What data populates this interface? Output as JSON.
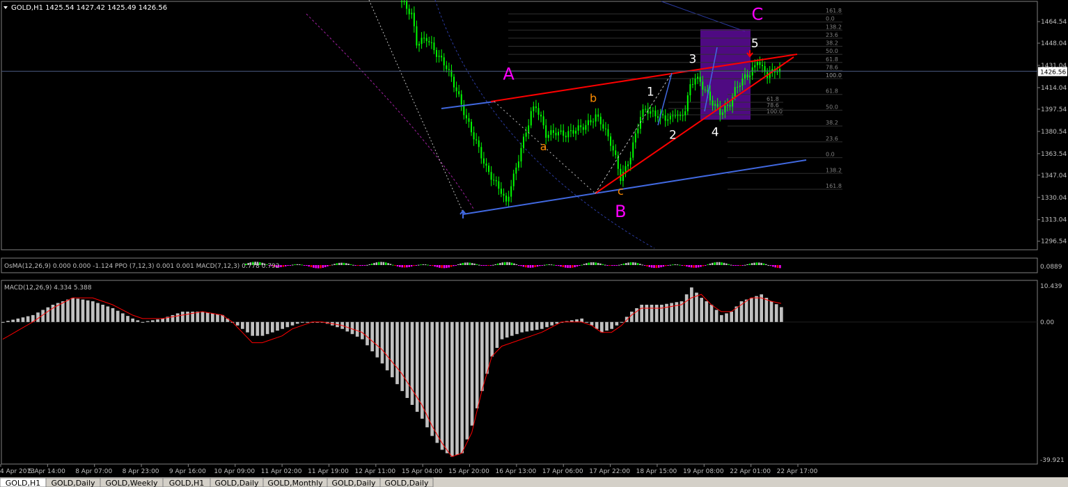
{
  "window": {
    "symbol_info": "GOLD,H1 1425.54 1427.42 1425.49 1426.56",
    "current_price": "1426.56"
  },
  "tabs": [
    "GOLD,H1",
    "GOLD,Daily",
    "GOLD,Weekly",
    "GOLD,H1",
    "GOLD,Daily",
    "GOLD,Monthly",
    "GOLD,Daily",
    "GOLD,Daily"
  ],
  "active_tab": 0,
  "colors": {
    "background": "#000000",
    "grid": "#808080",
    "candle": "#00ff00",
    "red_line": "#ff0000",
    "blue_line": "#4169e1",
    "wave_magenta": "#ff00ff",
    "wave_orange": "#ff8c00",
    "wave_white": "#ffffff",
    "fib_text": "#808080",
    "box": "#6a0dad",
    "macd_hist": "#c0c0c0",
    "macd_signal": "#ff0000"
  },
  "chart_data": [
    {
      "type": "candlestick",
      "title": "GOLD,H1",
      "ylim": [
        1290,
        1480
      ],
      "y_ticks": [
        "1464.54",
        "1448.04",
        "1431.04",
        "1414.04",
        "1397.54",
        "1380.54",
        "1363.54",
        "1347.04",
        "1330.04",
        "1313.04",
        "1296.54"
      ],
      "x_tick_labels": [
        "4 Apr 2013",
        "5 Apr 14:00",
        "8 Apr 07:00",
        "8 Apr 23:00",
        "9 Apr 16:00",
        "10 Apr 09:00",
        "11 Apr 02:00",
        "11 Apr 19:00",
        "12 Apr 11:00",
        "15 Apr 04:00",
        "15 Apr 20:00",
        "16 Apr 13:00",
        "17 Apr 06:00",
        "17 Apr 22:00",
        "18 Apr 15:00",
        "19 Apr 08:00",
        "22 Apr 01:00",
        "22 Apr 17:00"
      ],
      "close_path": [
        [
          0,
          1480
        ],
        [
          4,
          1470
        ],
        [
          6,
          1448
        ],
        [
          10,
          1452
        ],
        [
          14,
          1440
        ],
        [
          18,
          1430
        ],
        [
          22,
          1412
        ],
        [
          26,
          1390
        ],
        [
          30,
          1372
        ],
        [
          34,
          1352
        ],
        [
          38,
          1340
        ],
        [
          40,
          1335
        ],
        [
          42,
          1325
        ],
        [
          44,
          1340
        ],
        [
          46,
          1352
        ],
        [
          48,
          1368
        ],
        [
          50,
          1380
        ],
        [
          52,
          1395
        ],
        [
          54,
          1400
        ],
        [
          56,
          1390
        ],
        [
          58,
          1378
        ],
        [
          62,
          1380
        ],
        [
          66,
          1378
        ],
        [
          70,
          1382
        ],
        [
          74,
          1385
        ],
        [
          78,
          1392
        ],
        [
          80,
          1388
        ],
        [
          82,
          1380
        ],
        [
          84,
          1372
        ],
        [
          86,
          1360
        ],
        [
          88,
          1345
        ],
        [
          90,
          1352
        ],
        [
          92,
          1362
        ],
        [
          94,
          1378
        ],
        [
          96,
          1392
        ],
        [
          98,
          1398
        ],
        [
          100,
          1395
        ],
        [
          104,
          1392
        ],
        [
          108,
          1390
        ],
        [
          110,
          1395
        ],
        [
          112,
          1390
        ],
        [
          114,
          1398
        ],
        [
          116,
          1415
        ],
        [
          118,
          1422
        ],
        [
          120,
          1418
        ],
        [
          122,
          1412
        ],
        [
          124,
          1405
        ],
        [
          126,
          1400
        ],
        [
          128,
          1395
        ],
        [
          130,
          1398
        ],
        [
          132,
          1402
        ],
        [
          134,
          1412
        ],
        [
          136,
          1418
        ],
        [
          138,
          1422
        ],
        [
          140,
          1425
        ],
        [
          142,
          1430
        ],
        [
          143,
          1436
        ],
        [
          145,
          1428
        ],
        [
          147,
          1424
        ],
        [
          149,
          1426
        ],
        [
          151,
          1428
        ],
        [
          152,
          1426.56
        ]
      ],
      "current_price": 1426.56,
      "wave_labels": [
        {
          "text": "A",
          "x": 43,
          "y": 1420,
          "color": "magenta"
        },
        {
          "text": "B",
          "x": 88,
          "y": 1315,
          "color": "magenta"
        },
        {
          "text": "C",
          "x": 143,
          "y": 1466,
          "color": "magenta"
        },
        {
          "text": "a",
          "x": 57,
          "y": 1366,
          "color": "orange"
        },
        {
          "text": "b",
          "x": 77,
          "y": 1403,
          "color": "orange"
        },
        {
          "text": "c",
          "x": 88,
          "y": 1332,
          "color": "orange"
        },
        {
          "text": "1",
          "x": 100,
          "y": 1408,
          "color": "white"
        },
        {
          "text": "2",
          "x": 109,
          "y": 1375,
          "color": "white"
        },
        {
          "text": "3",
          "x": 117,
          "y": 1433,
          "color": "white"
        },
        {
          "text": "4",
          "x": 126,
          "y": 1377,
          "color": "white"
        },
        {
          "text": "5",
          "x": 142,
          "y": 1445,
          "color": "white"
        }
      ],
      "fib_levels_upper": [
        "161.8",
        "0.0",
        "138.2",
        "23.6",
        "38.2",
        "50.0",
        "61.8",
        "78.6",
        "100.0"
      ],
      "fib_levels_mid": [
        "100.0",
        "78.6",
        "61.8"
      ],
      "fib_levels_lower": [
        "100.0",
        "61.8",
        "50.0",
        "38.2",
        "23.6",
        "0.0",
        "138.2",
        "161.8"
      ]
    },
    {
      "type": "bar",
      "title": "OsMA(12,26,9) 0.000 0.000 -1.124  PPO (7,12,3) 0.001 0.001  MACD(7,12,3) 0.778 0.792",
      "right_label": "0.0889"
    },
    {
      "type": "bar",
      "title": "MACD(12,26,9) 4.334 5.388",
      "ylim": [
        -39.921,
        10.439
      ],
      "y_ticks": [
        "10.439",
        "0.00",
        "-39.921"
      ],
      "main_path": [
        [
          0,
          0
        ],
        [
          6,
          2
        ],
        [
          10,
          5
        ],
        [
          14,
          7
        ],
        [
          18,
          6
        ],
        [
          22,
          4
        ],
        [
          26,
          1
        ],
        [
          28,
          0
        ],
        [
          32,
          1
        ],
        [
          36,
          3
        ],
        [
          40,
          3
        ],
        [
          44,
          2
        ],
        [
          46,
          0
        ],
        [
          48,
          -2
        ],
        [
          50,
          -4
        ],
        [
          52,
          -4
        ],
        [
          54,
          -3
        ],
        [
          56,
          -2
        ],
        [
          58,
          -1
        ],
        [
          60,
          0
        ],
        [
          62,
          0
        ],
        [
          64,
          0
        ],
        [
          68,
          -2
        ],
        [
          72,
          -5
        ],
        [
          76,
          -12
        ],
        [
          80,
          -20
        ],
        [
          84,
          -28
        ],
        [
          86,
          -33
        ],
        [
          88,
          -37
        ],
        [
          90,
          -39
        ],
        [
          92,
          -38
        ],
        [
          94,
          -30
        ],
        [
          96,
          -20
        ],
        [
          98,
          -10
        ],
        [
          100,
          -5
        ],
        [
          104,
          -3
        ],
        [
          108,
          -2
        ],
        [
          112,
          0
        ],
        [
          116,
          1
        ],
        [
          118,
          -1
        ],
        [
          120,
          -3
        ],
        [
          122,
          -2
        ],
        [
          124,
          0
        ],
        [
          126,
          3
        ],
        [
          128,
          5
        ],
        [
          132,
          5
        ],
        [
          136,
          6
        ],
        [
          138,
          10
        ],
        [
          140,
          7
        ],
        [
          142,
          5
        ],
        [
          144,
          2
        ],
        [
          146,
          3
        ],
        [
          148,
          6
        ],
        [
          150,
          7
        ],
        [
          152,
          8
        ],
        [
          154,
          6
        ],
        [
          156,
          4.3
        ]
      ],
      "signal_path": [
        [
          0,
          -5
        ],
        [
          6,
          0
        ],
        [
          10,
          4
        ],
        [
          14,
          7
        ],
        [
          18,
          7
        ],
        [
          22,
          5
        ],
        [
          26,
          2
        ],
        [
          28,
          1
        ],
        [
          32,
          1
        ],
        [
          36,
          2
        ],
        [
          40,
          3
        ],
        [
          44,
          2
        ],
        [
          46,
          0
        ],
        [
          48,
          -3
        ],
        [
          50,
          -6
        ],
        [
          52,
          -6
        ],
        [
          54,
          -5
        ],
        [
          56,
          -4
        ],
        [
          58,
          -2
        ],
        [
          60,
          -1
        ],
        [
          62,
          0
        ],
        [
          64,
          0
        ],
        [
          68,
          -1
        ],
        [
          72,
          -3
        ],
        [
          76,
          -8
        ],
        [
          80,
          -15
        ],
        [
          84,
          -24
        ],
        [
          86,
          -30
        ],
        [
          88,
          -35
        ],
        [
          90,
          -39
        ],
        [
          92,
          -38
        ],
        [
          94,
          -32
        ],
        [
          96,
          -20
        ],
        [
          98,
          -10
        ],
        [
          100,
          -7
        ],
        [
          104,
          -5
        ],
        [
          108,
          -3
        ],
        [
          112,
          0
        ],
        [
          116,
          0
        ],
        [
          118,
          -1
        ],
        [
          120,
          -3
        ],
        [
          122,
          -3
        ],
        [
          124,
          -1
        ],
        [
          126,
          2
        ],
        [
          128,
          4
        ],
        [
          132,
          4
        ],
        [
          136,
          5
        ],
        [
          138,
          7
        ],
        [
          140,
          8
        ],
        [
          142,
          5
        ],
        [
          144,
          3
        ],
        [
          146,
          3
        ],
        [
          148,
          5
        ],
        [
          150,
          7
        ],
        [
          152,
          7
        ],
        [
          154,
          6
        ],
        [
          156,
          5.388
        ]
      ]
    }
  ]
}
